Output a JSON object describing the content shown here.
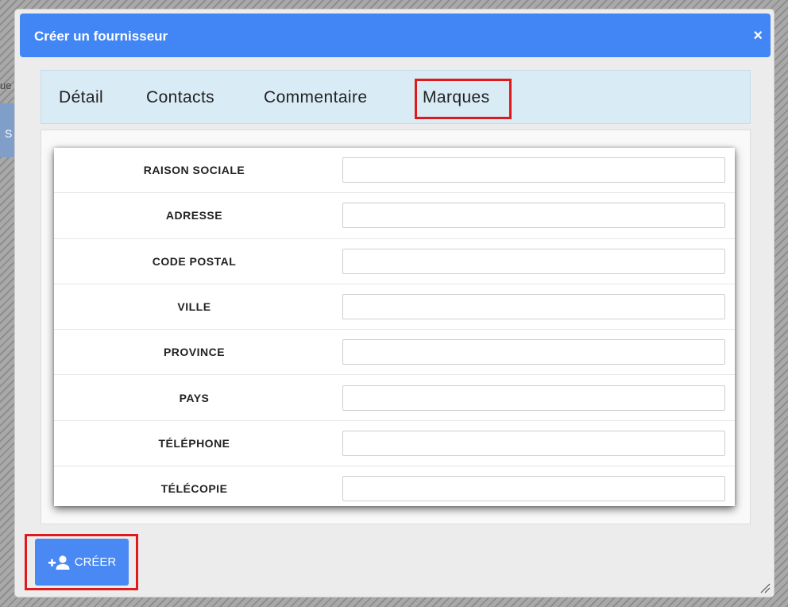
{
  "background": {
    "fragment_left": "ue",
    "fragment_button": "S"
  },
  "dialog": {
    "title": "Créer un fournisseur",
    "close_glyph": "×",
    "accent_color": "#4285f4",
    "highlight_color": "#e0191c"
  },
  "tabs": [
    {
      "label": "Détail"
    },
    {
      "label": "Contacts"
    },
    {
      "label": "Commentaire"
    },
    {
      "label": "Marques"
    }
  ],
  "form": {
    "fields": [
      {
        "label": "RAISON SOCIALE",
        "value": ""
      },
      {
        "label": "ADRESSE",
        "value": ""
      },
      {
        "label": "CODE POSTAL",
        "value": ""
      },
      {
        "label": "VILLE",
        "value": ""
      },
      {
        "label": "PROVINCE",
        "value": ""
      },
      {
        "label": "PAYS",
        "value": ""
      },
      {
        "label": "TÉLÉPHONE",
        "value": ""
      },
      {
        "label": "TÉLÉCOPIE",
        "value": ""
      }
    ]
  },
  "actions": {
    "create_label": "CRÉER",
    "create_icon": "add-user-icon"
  }
}
